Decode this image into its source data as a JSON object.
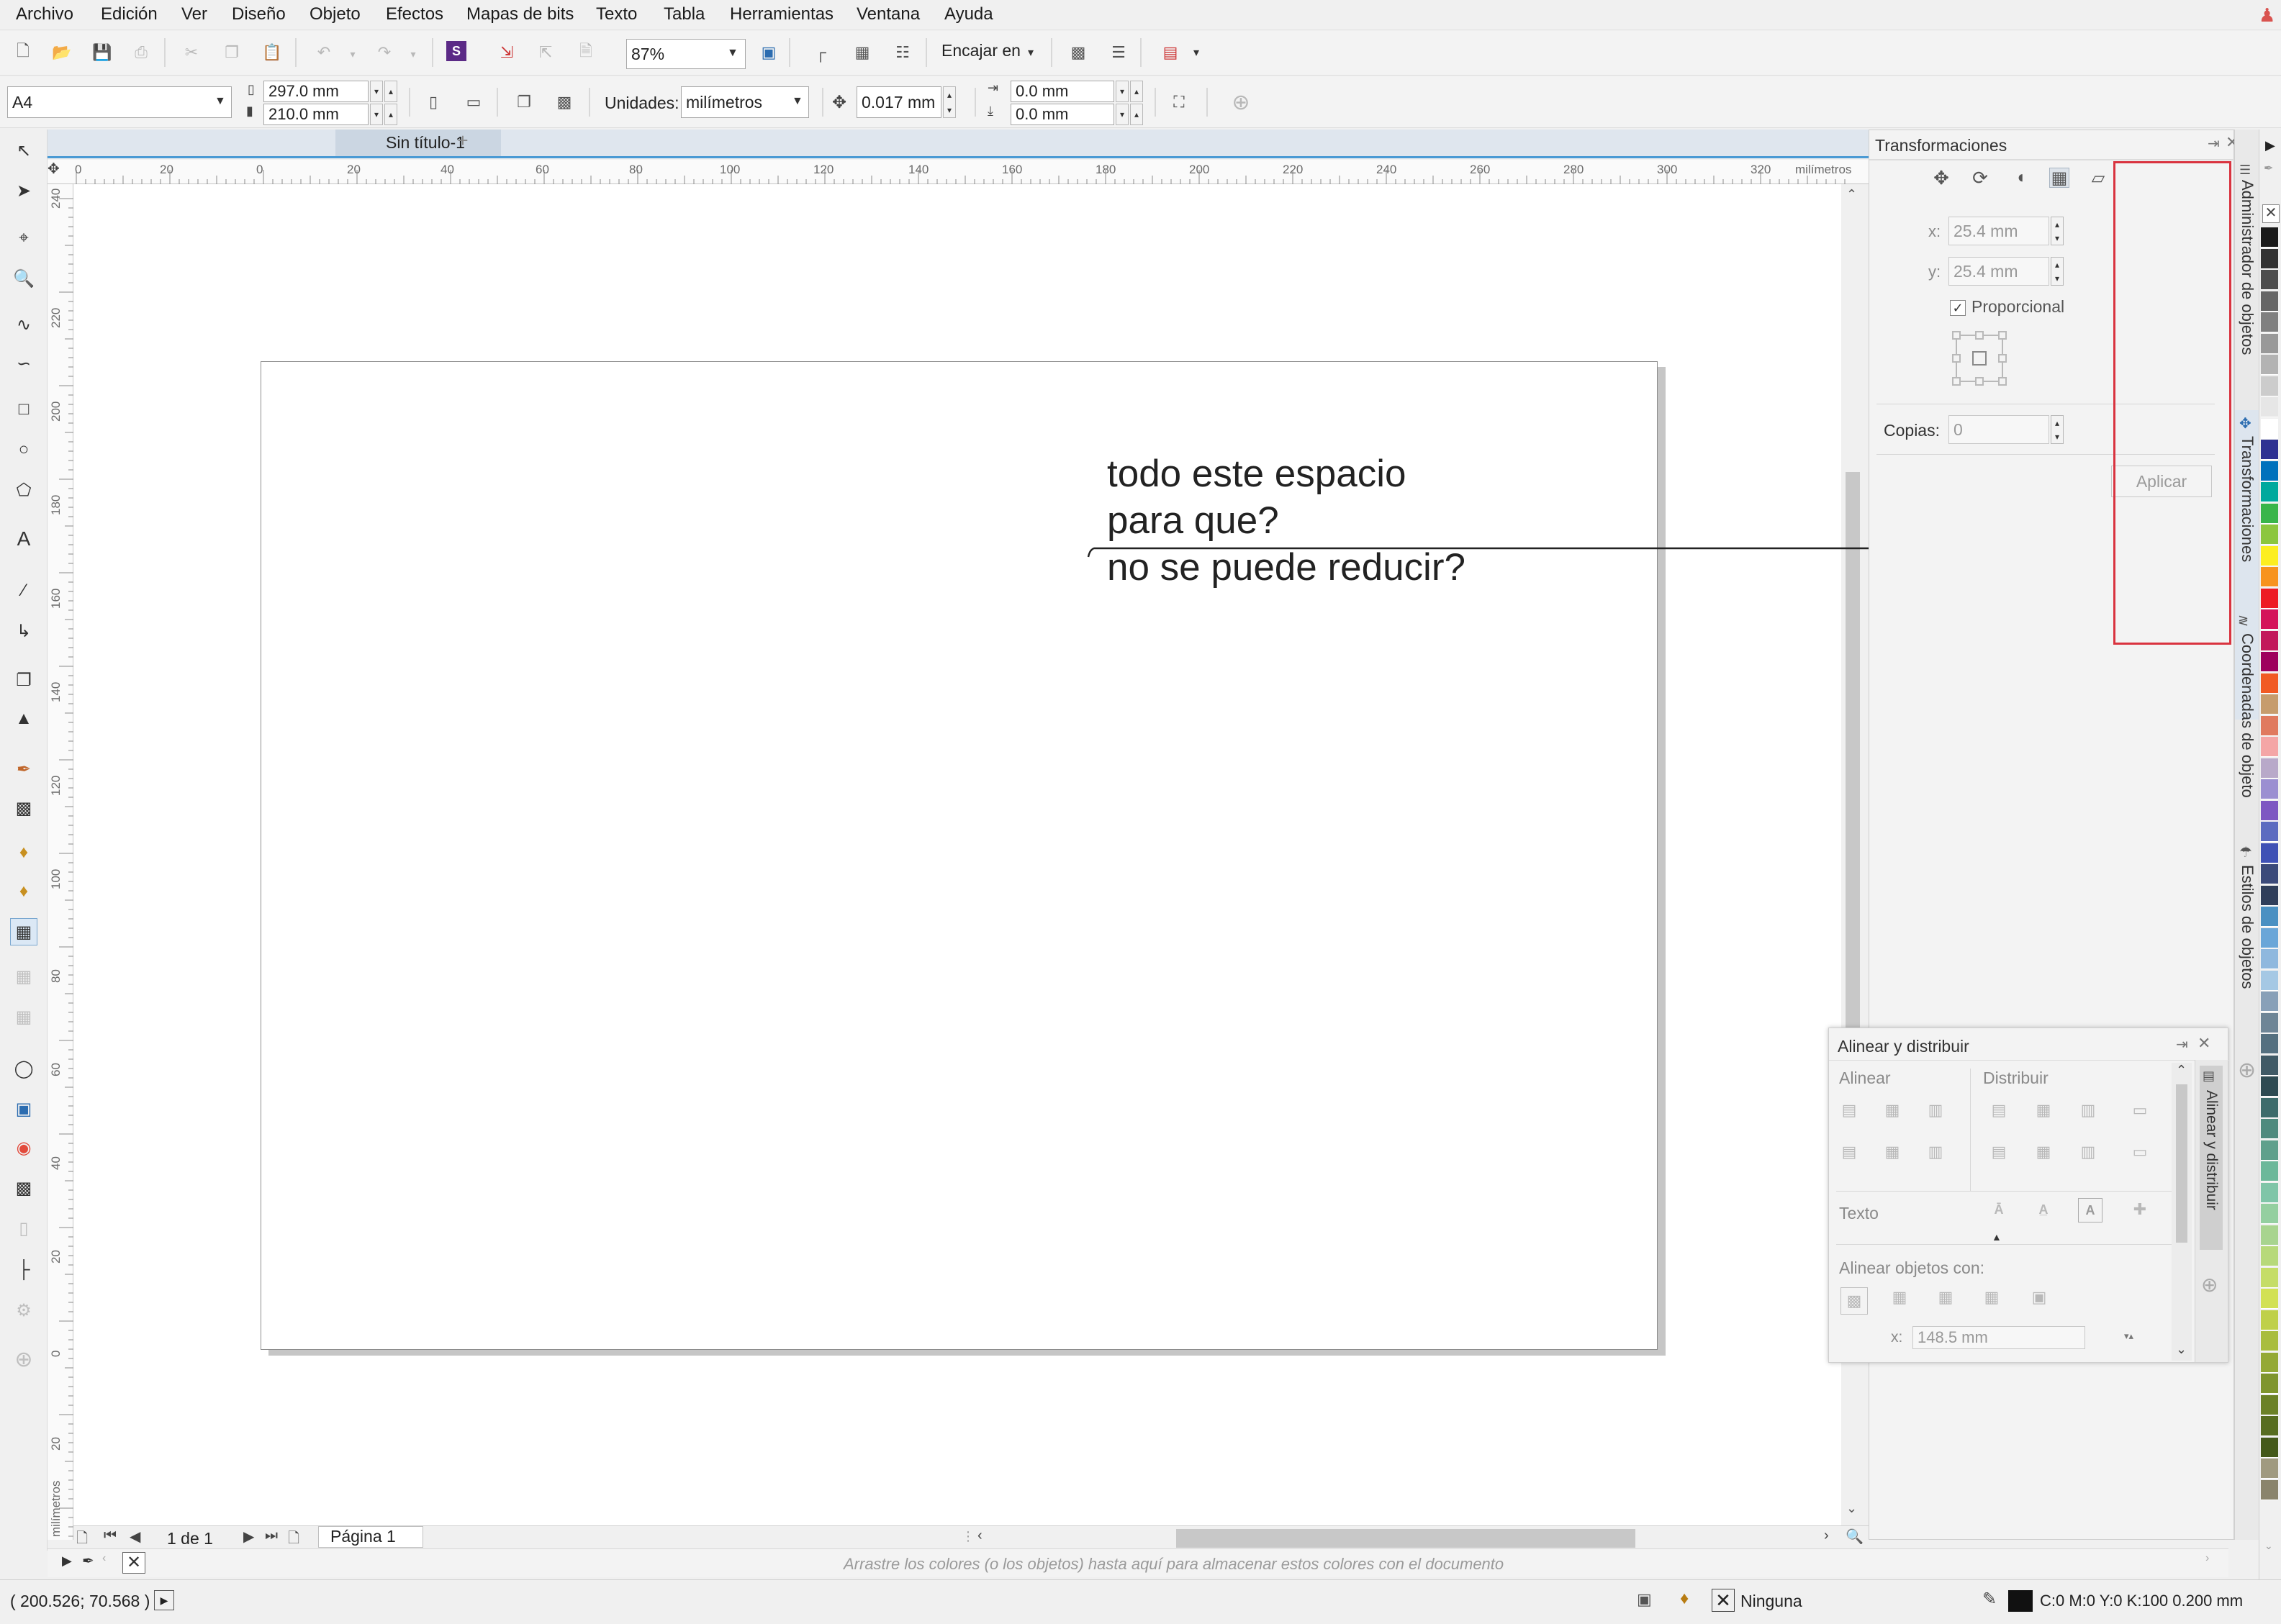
{
  "menu": {
    "items": [
      "Archivo",
      "Edición",
      "Ver",
      "Diseño",
      "Objeto",
      "Efectos",
      "Mapas de bits",
      "Texto",
      "Tabla",
      "Herramientas",
      "Ventana",
      "Ayuda"
    ]
  },
  "toolbar": {
    "zoom_value": "87%",
    "snap_label": "Encajar en"
  },
  "property_bar": {
    "page_size": "A4",
    "width": "297.0 mm",
    "height": "210.0 mm",
    "units_label": "Unidades:",
    "units_value": "milímetros",
    "nudge_value": "0.017 mm",
    "dup_x": "0.0 mm",
    "dup_y": "0.0 mm"
  },
  "document": {
    "tab_title": "Sin título-1",
    "ruler_units": "milímetros",
    "h_ruler_ticks": [
      "0",
      "20",
      "0",
      "20",
      "40",
      "60",
      "80",
      "100",
      "120",
      "140",
      "160",
      "180",
      "200",
      "220",
      "240",
      "260",
      "280",
      "300",
      "320"
    ],
    "v_ruler_ticks": [
      "240",
      "220",
      "200",
      "180",
      "160",
      "140",
      "120",
      "100",
      "80",
      "60",
      "40",
      "20",
      "0",
      "20"
    ],
    "v_ruler_units": "milímetros"
  },
  "annotation": {
    "line1": "todo este espacio",
    "line2": "para que?",
    "line3": "no se puede reducir?",
    "highlight_color": "#d9333f"
  },
  "transform_panel": {
    "title": "Transformaciones",
    "x_label": "x:",
    "x_value": "25.4 mm",
    "y_label": "y:",
    "y_value": "25.4 mm",
    "proportional_label": "Proporcional",
    "copies_label": "Copias:",
    "copies_value": "0",
    "apply_label": "Aplicar"
  },
  "side_tabs": {
    "object_manager": "Administrador de objetos",
    "transformations": "Transformaciones",
    "object_coords": "Coordenadas de objeto",
    "object_styles": "Estilos de objetos",
    "align_distribute": "Alinear y distribuir"
  },
  "align_panel": {
    "title": "Alinear y distribuir",
    "align_label": "Alinear",
    "distribute_label": "Distribuir",
    "text_label": "Texto",
    "align_with_label": "Alinear objetos con:",
    "x_label": "x:",
    "x_value": "148.5 mm"
  },
  "page_nav": {
    "count": "1 de 1",
    "page_tab": "Página 1"
  },
  "doc_palette": {
    "hint": "Arrastre los colores (o los objetos) hasta aquí para almacenar estos colores con el documento"
  },
  "status": {
    "coords": "( 200.526; 70.568 )",
    "fill_label": "Ninguna",
    "outline_info": "C:0 M:0 Y:0 K:100  0.200 mm"
  },
  "palette_colors": [
    "#1a1a1a",
    "#333333",
    "#4d4d4d",
    "#666666",
    "#808080",
    "#999999",
    "#b3b3b3",
    "#cccccc",
    "#e6e6e6",
    "#ffffff",
    "#2e3192",
    "#0071bc",
    "#00a99d",
    "#39b54a",
    "#8cc63f",
    "#fcee21",
    "#f7931e",
    "#ed1c24",
    "#d4145a",
    "#c2185b",
    "#9e005d",
    "#f15a24",
    "#c69c6d",
    "#e07a5f",
    "#f4a6a6",
    "#b8a9c9",
    "#9b8fd1",
    "#7e57c2",
    "#5c6bc0",
    "#3f51b5",
    "#3b4a7a",
    "#2f3e5a",
    "#4a90c2",
    "#6aa6d8",
    "#8fb8de",
    "#a5c8e4",
    "#88a0b8",
    "#6e8596",
    "#557080",
    "#405a66",
    "#2e4a52",
    "#3d6b6b",
    "#4f8a7e",
    "#5fa08c",
    "#6cb89a",
    "#7fc5a8",
    "#94cfa0",
    "#a8d48f",
    "#b7d97a",
    "#c5dd67",
    "#d2e155",
    "#bfd04a",
    "#a9bd3f",
    "#94a936",
    "#7f952e",
    "#6b8127",
    "#576d20",
    "#44591a",
    "#a09a80",
    "#8a846c"
  ]
}
